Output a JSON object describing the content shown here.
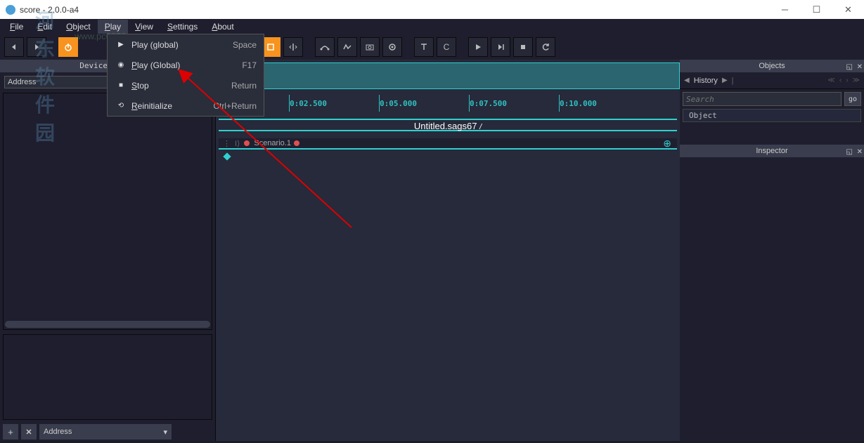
{
  "app_title": "score - 2.0.0-a4",
  "menus": [
    "File",
    "Edit",
    "Object",
    "Play",
    "View",
    "Settings",
    "About"
  ],
  "dropdown": {
    "items": [
      {
        "icon": "play",
        "label_pre": "",
        "label_ul": "",
        "label_post": "Play (global)",
        "shortcut": "Space"
      },
      {
        "icon": "play-circle",
        "label_pre": "",
        "label_ul": "P",
        "label_post": "lay (Global)",
        "shortcut": "F17"
      },
      {
        "icon": "stop",
        "label_pre": "",
        "label_ul": "S",
        "label_post": "top",
        "shortcut": "Return"
      },
      {
        "icon": "reload",
        "label_pre": "",
        "label_ul": "R",
        "label_post": "einitialize",
        "shortcut": "Ctrl+Return"
      }
    ]
  },
  "left": {
    "header": "Device Expl…",
    "address_label": "Address",
    "footer_select": "Address"
  },
  "timeline": {
    "ticks": [
      "0:02.500",
      "0:05.000",
      "0:07.500",
      "0:10.000"
    ],
    "title": "Untitled.sags67",
    "track_label": "Scenario.1"
  },
  "right": {
    "objects_header": "Objects",
    "history_label": "History",
    "search_placeholder": "Search",
    "go_label": "go",
    "object_label": "Object",
    "inspector_header": "Inspector"
  },
  "watermark": {
    "text": "河东软件园",
    "url": "www.pc0359.cn"
  }
}
